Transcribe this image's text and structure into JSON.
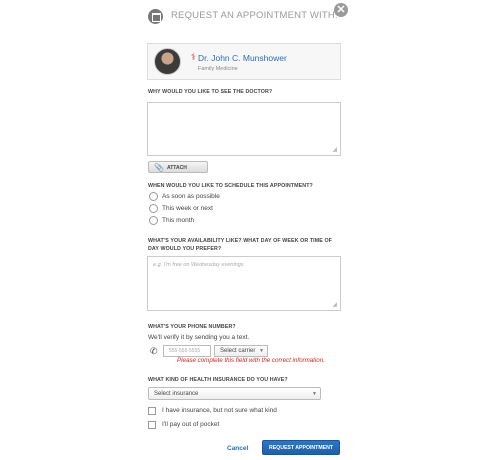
{
  "header": {
    "title": "REQUEST AN APPOINTMENT WITH:",
    "close_glyph": "✕"
  },
  "doctor": {
    "name": "Dr. John C. Munshower",
    "specialty": "Family Medicine",
    "badge_glyph": "⚕"
  },
  "reason": {
    "label": "WHY WOULD YOU LIKE TO SEE THE DOCTOR?",
    "value": "",
    "placeholder": ""
  },
  "attach": {
    "label": "ATTACH",
    "icon_glyph": "📎"
  },
  "schedule": {
    "label": "WHEN WOULD YOU LIKE TO SCHEDULE THIS APPOINTMENT?",
    "options": [
      "As soon as possible",
      "This week or next",
      "This month"
    ]
  },
  "availability": {
    "label_line1": "WHAT'S YOUR AVAILABILITY LIKE? WHAT DAY OF WEEK OR TIME OF",
    "label_line2": "DAY WOULD YOU PREFER?",
    "placeholder": "e.g. I'm free on Wednesday evenings."
  },
  "phone": {
    "label": "WHAT'S YOUR PHONE NUMBER?",
    "subtext": "We'll verify it by sending you a text.",
    "placeholder": "555-555-5555",
    "carrier": "Select carrier",
    "error": "Please complete this field with the correct information.",
    "icon_glyph": "✆"
  },
  "insurance": {
    "label": "WHAT KIND OF HEALTH INSURANCE DO YOU HAVE?",
    "select": "Select insurance",
    "options": [
      "I have insurance, but not sure what kind",
      "I'll pay out of pocket"
    ]
  },
  "actions": {
    "cancel": "Cancel",
    "submit": "REQUEST APPOINTMENT"
  },
  "colors": {
    "accent": "#2a6fb7",
    "error": "#dd2222",
    "button": "#1f5fa8"
  }
}
